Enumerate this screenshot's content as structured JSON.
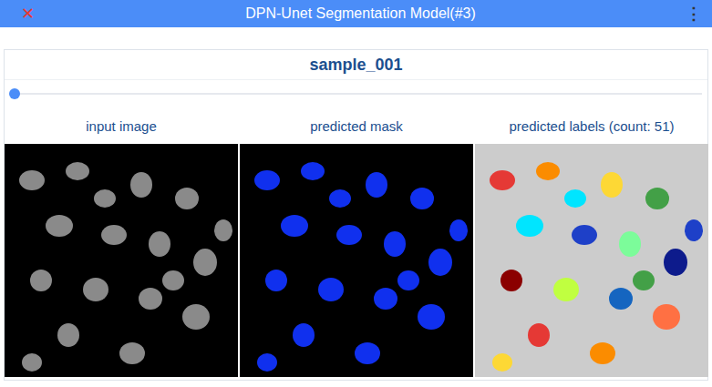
{
  "window": {
    "title": "DPN-Unet Segmentation Model(#3)",
    "close_icon": "✕",
    "menu_icon": "⋮"
  },
  "sample": {
    "title": "sample_001",
    "slider": {
      "level": 0
    }
  },
  "panels": [
    {
      "label": "input image",
      "kind": "image"
    },
    {
      "label": "predicted mask",
      "kind": "mask"
    },
    {
      "label": "predicted labels (count: 51)",
      "kind": "labels"
    }
  ]
}
